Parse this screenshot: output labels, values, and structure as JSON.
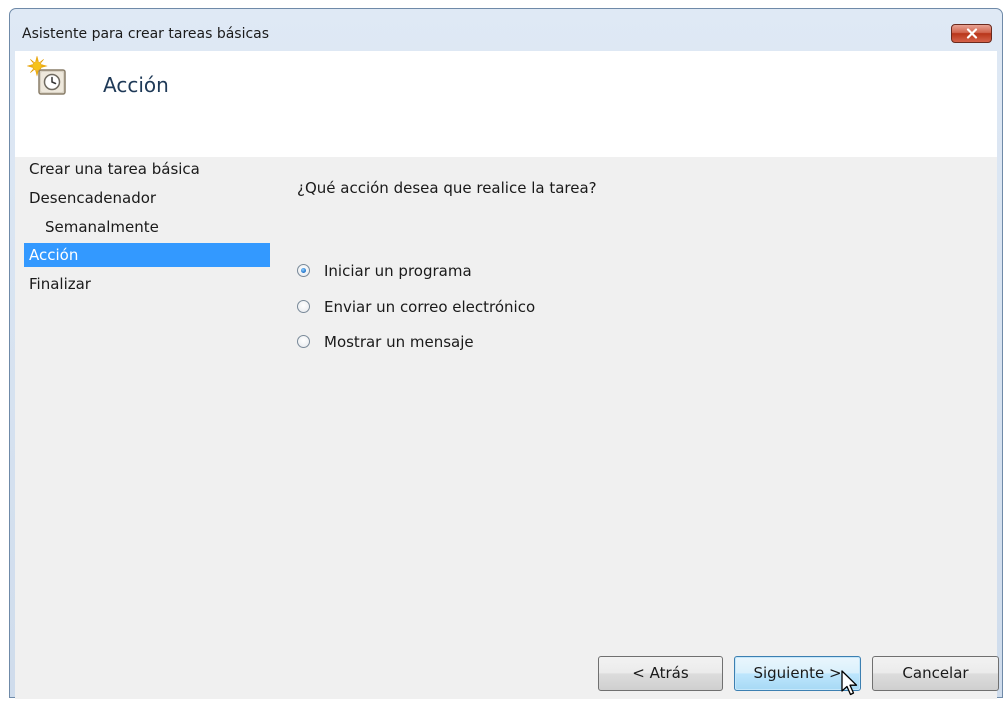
{
  "window": {
    "title": "Asistente para crear tareas básicas",
    "close_label": "x"
  },
  "header": {
    "icon": "task-scheduler-clock-icon",
    "title": "Acción"
  },
  "nav": {
    "items": [
      {
        "label": "Crear una tarea básica",
        "indent": 0,
        "selected": false
      },
      {
        "label": "Desencadenador",
        "indent": 0,
        "selected": false
      },
      {
        "label": "Semanalmente",
        "indent": 1,
        "selected": false
      },
      {
        "label": "Acción",
        "indent": 0,
        "selected": true
      },
      {
        "label": "Finalizar",
        "indent": 0,
        "selected": false
      }
    ]
  },
  "main": {
    "question": "¿Qué acción desea que realice la tarea?",
    "options": [
      {
        "label": "Iniciar un programa",
        "checked": true
      },
      {
        "label": "Enviar un correo electrónico",
        "checked": false
      },
      {
        "label": "Mostrar un mensaje",
        "checked": false
      }
    ]
  },
  "buttons": {
    "back": "< Atrás",
    "next": "Siguiente >",
    "cancel": "Cancelar"
  },
  "colors": {
    "selection": "#3399ff",
    "header_title": "#1e3957",
    "close_button": "#c7432a"
  }
}
